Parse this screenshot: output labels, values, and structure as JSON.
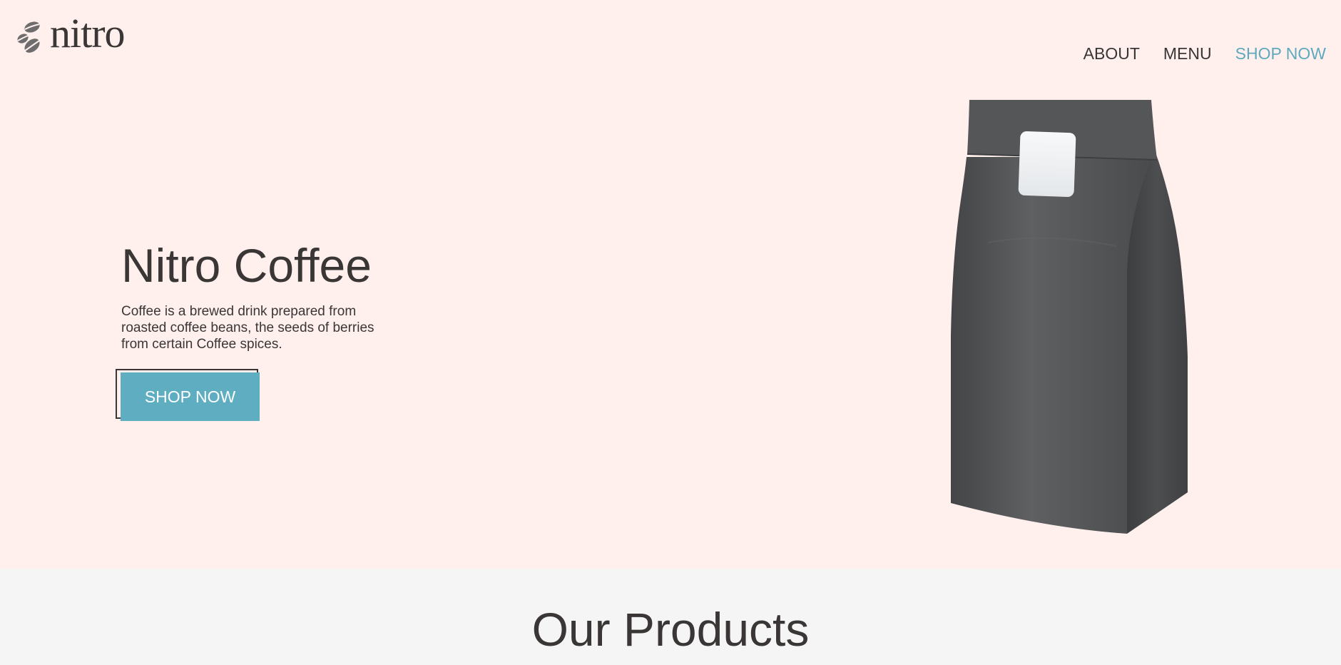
{
  "brand": {
    "name": "nitro"
  },
  "nav": {
    "items": [
      {
        "label": "ABOUT"
      },
      {
        "label": "MENU"
      },
      {
        "label": "SHOP NOW"
      }
    ]
  },
  "hero": {
    "title": "Nitro Coffee",
    "description": "Coffee is a brewed drink prepared from roasted coffee beans, the seeds of berries from certain Coffee spices.",
    "cta_label": "SHOP NOW",
    "image": "coffee-bag"
  },
  "products": {
    "title": "Our Products"
  },
  "colors": {
    "hero_background": "#fff0ee",
    "products_background": "#f6f5f5",
    "accent": "#5fadc1",
    "text": "#3a3636",
    "bag": "#4e4f51"
  },
  "icons": {
    "logo": "coffee-beans-icon"
  }
}
